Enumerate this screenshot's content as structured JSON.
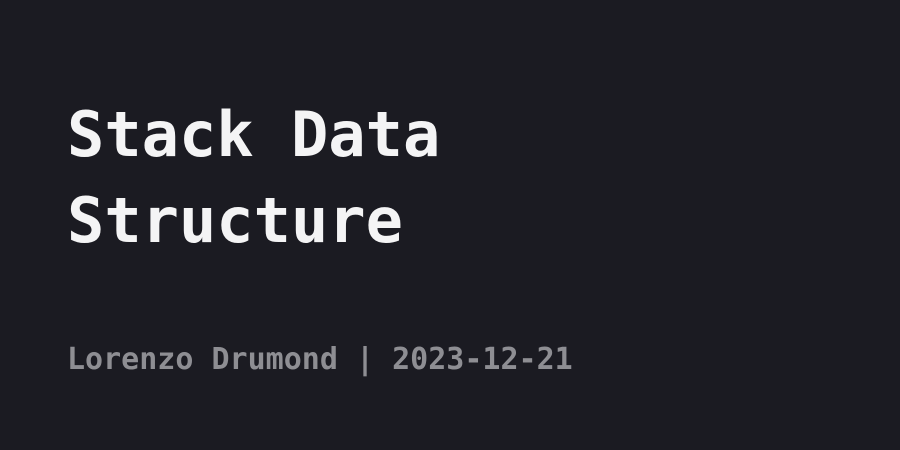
{
  "post": {
    "title_line1": "Stack Data",
    "title_line2": "Structure",
    "author": "Lorenzo Drumond",
    "separator": "|",
    "date": "2023-12-21"
  },
  "colors": {
    "background": "#1b1b22",
    "title": "#f4f4f5",
    "byline": "#8e8e93"
  }
}
